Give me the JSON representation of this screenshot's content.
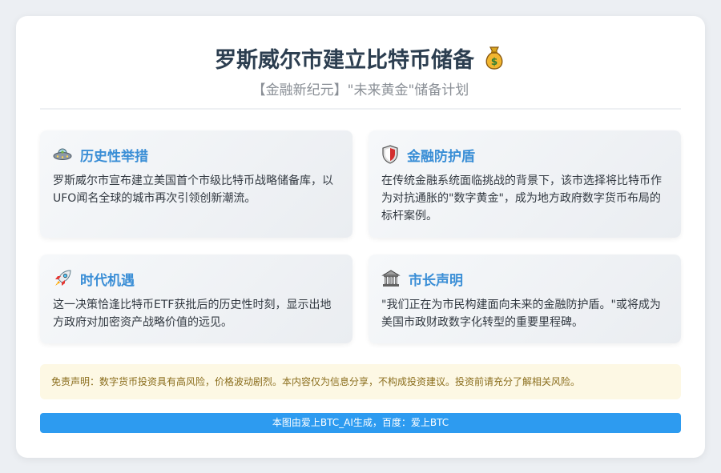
{
  "header": {
    "title": "罗斯威尔市建立比特币储备",
    "title_icon": "money-bag-icon",
    "subtitle": "【金融新纪元】\"未来黄金\"储备计划"
  },
  "cards": [
    {
      "icon": "ufo-icon",
      "title": "历史性举措",
      "body": "罗斯威尔市宣布建立美国首个市级比特币战略储备库，以UFO闻名全球的城市再次引领创新潮流。"
    },
    {
      "icon": "shield-icon",
      "title": "金融防护盾",
      "body": "在传统金融系统面临挑战的背景下，该市选择将比特币作为对抗通胀的\"数字黄金\"，成为地方政府数字货币布局的标杆案例。"
    },
    {
      "icon": "rocket-icon",
      "title": "时代机遇",
      "body": "这一决策恰逢比特币ETF获批后的历史性时刻，显示出地方政府对加密资产战略价值的远见。"
    },
    {
      "icon": "bank-icon",
      "title": "市长声明",
      "body": "\"我们正在为市民构建面向未来的金融防护盾。\"或将成为美国市政财政数字化转型的重要里程碑。"
    }
  ],
  "disclaimer": "免责声明：数字货币投资具有高风险，价格波动剧烈。本内容仅为信息分享，不构成投资建议。投资前请充分了解相关风险。",
  "footer": "本图由爱上BTC_AI生成，百度：爱上BTC",
  "colors": {
    "title": "#2c3e50",
    "card_title": "#3a8ed6",
    "footer_bg": "#2d9bf0",
    "disclaimer_bg": "#fdf8e4",
    "disclaimer_text": "#8a6d1c"
  }
}
